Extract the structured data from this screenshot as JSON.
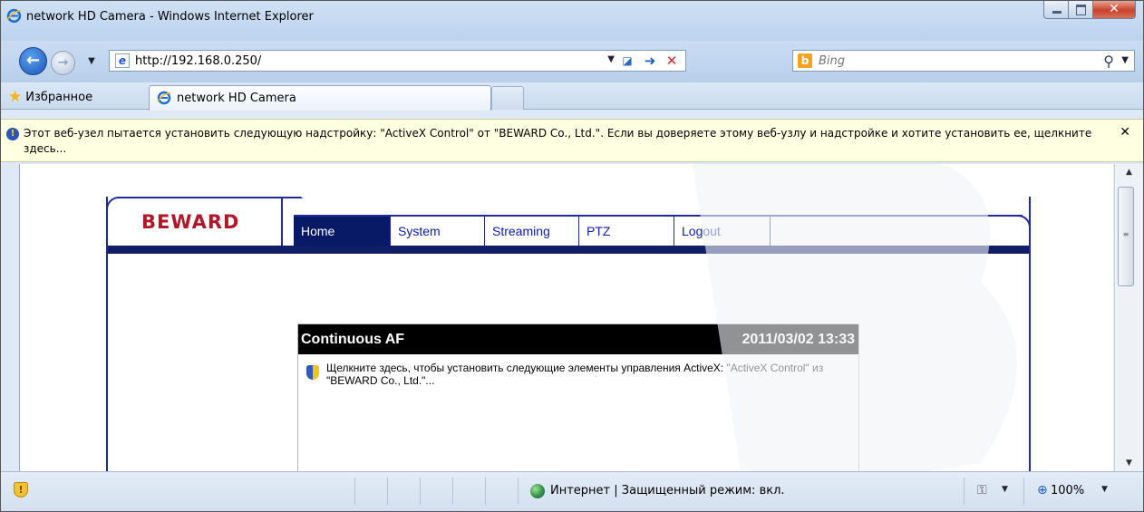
{
  "window": {
    "title": "network HD Camera - Windows Internet Explorer"
  },
  "address": {
    "url": "http://192.168.0.250/"
  },
  "search": {
    "placeholder": "Bing"
  },
  "favorites": {
    "label": "Избранное"
  },
  "tab": {
    "title": "network HD Camera"
  },
  "infobar": {
    "text": "Этот веб-узел пытается установить следующую надстройку: \"ActiveX Control\" от \"BEWARD Co., Ltd.\". Если вы доверяете этому веб-узлу и надстройке и хотите установить ее, щелкните здесь..."
  },
  "camera": {
    "logo": "BEWARD",
    "menu": [
      {
        "label": "Home",
        "active": true
      },
      {
        "label": "System"
      },
      {
        "label": "Streaming"
      },
      {
        "label": "PTZ"
      },
      {
        "label": "Logout"
      }
    ],
    "video": {
      "mode": "Continuous AF",
      "datetime": "2011/03/02 13:33",
      "activex_message": "Щелкните здесь, чтобы установить следующие элементы управления ActiveX: \"ActiveX Control\" из \"BEWARD Co., Ltd.\"..."
    }
  },
  "statusbar": {
    "zone": "Интернет | Защищенный режим: вкл.",
    "zoom": "100%"
  },
  "icons": [
    "ie-icon",
    "back-arrow-icon",
    "forward-arrow-icon",
    "page-icon",
    "compatibility-icon",
    "go-arrow-icon",
    "stop-icon",
    "bing-icon",
    "search-icon",
    "star-icon",
    "shield-icon",
    "close-icon",
    "globe-icon",
    "lock-icon",
    "zoom-icon",
    "warning-shield-icon"
  ],
  "colors": {
    "accent": "#1f2aa0",
    "menu_active": "#081a66",
    "logo": "#b0182a",
    "infobar": "#ffffe1"
  }
}
